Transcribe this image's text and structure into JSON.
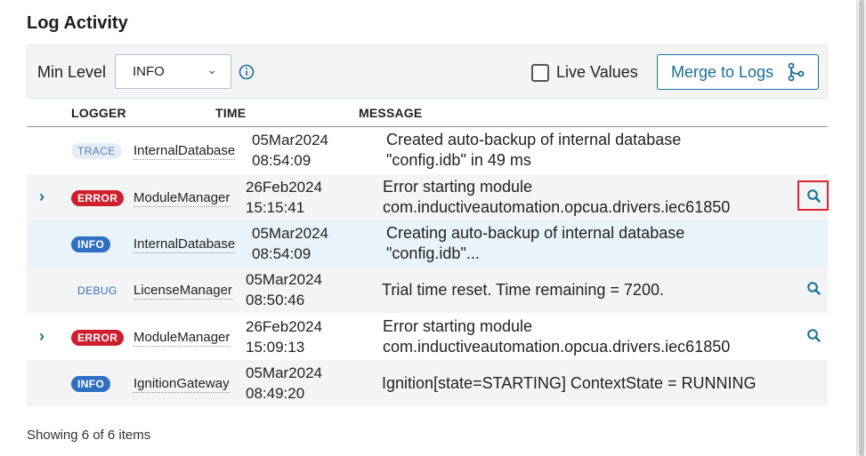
{
  "panel": {
    "title": "Log Activity"
  },
  "toolbar": {
    "min_level_label": "Min Level",
    "min_level_value": "INFO",
    "live_values_label": "Live Values",
    "live_values_checked": false,
    "merge_label": "Merge to Logs"
  },
  "columns": {
    "logger": "LOGGER",
    "time": "TIME",
    "message": "MESSAGE"
  },
  "rows": [
    {
      "level": "TRACE",
      "logger": "InternalDatabase",
      "date": "05Mar2024",
      "time": "08:54:09",
      "message": [
        "Created auto-backup of internal database",
        "\"config.idb\" in 49 ms"
      ],
      "expandable": false,
      "has_search": false
    },
    {
      "level": "ERROR",
      "logger": "ModuleManager",
      "date": "26Feb2024",
      "time": "15:15:41",
      "message": [
        "Error starting module",
        "com.inductiveautomation.opcua.drivers.iec61850"
      ],
      "expandable": true,
      "has_search": true,
      "search_highlighted": true
    },
    {
      "level": "INFO",
      "logger": "InternalDatabase",
      "date": "05Mar2024",
      "time": "08:54:09",
      "message": [
        "Creating auto-backup of internal database",
        "\"config.idb\"..."
      ],
      "expandable": false,
      "has_search": false,
      "selected": true
    },
    {
      "level": "DEBUG",
      "logger": "LicenseManager",
      "date": "05Mar2024",
      "time": "08:50:46",
      "message": [
        "Trial time reset. Time remaining = 7200."
      ],
      "expandable": false,
      "has_search": true
    },
    {
      "level": "ERROR",
      "logger": "ModuleManager",
      "date": "26Feb2024",
      "time": "15:09:13",
      "message": [
        "Error starting module",
        "com.inductiveautomation.opcua.drivers.iec61850"
      ],
      "expandable": true,
      "has_search": true
    },
    {
      "level": "INFO",
      "logger": "IgnitionGateway",
      "date": "05Mar2024",
      "time": "08:49:20",
      "message": [
        "Ignition[state=STARTING] ContextState = RUNNING"
      ],
      "expandable": false,
      "has_search": false
    }
  ],
  "footer": {
    "summary": "Showing 6 of 6 items"
  },
  "colors": {
    "accent": "#1b6f96",
    "error": "#cf1e2d",
    "info": "#2f6fc4",
    "highlight": "#e0242f"
  }
}
